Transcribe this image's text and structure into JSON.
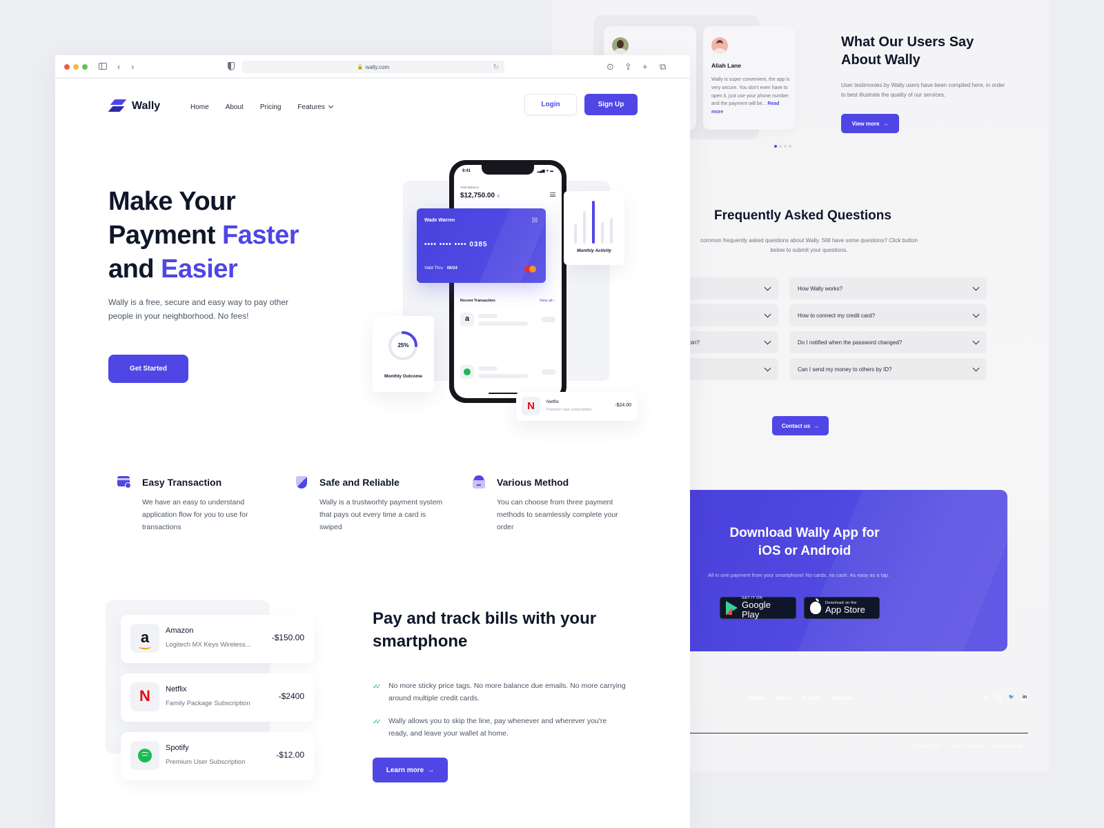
{
  "browser": {
    "url": "wally.com"
  },
  "nav": {
    "brand": "Wally",
    "links": [
      "Home",
      "About",
      "Pricing",
      "Features"
    ],
    "login": "Login",
    "signup": "Sign Up"
  },
  "hero": {
    "title_line1": "Make Your",
    "title_line2a": "Payment ",
    "title_line2b": "Faster",
    "title_line3a": "and ",
    "title_line3b": "Easier",
    "subtitle": "Wally is a free, secure and easy way to pay other people in your neighborhood. No fees!",
    "cta": "Get Started"
  },
  "phone": {
    "time": "9:41",
    "status_icons": "▂▄▆ ᯤ ▬",
    "balance_label": "Total Balance",
    "balance": "$12,750.00",
    "card_holder": "Wade Warren",
    "card_number": "•••• •••• •••• 0385",
    "valid_label": "Valid Thru",
    "valid_value": "06/24",
    "recent_label": "Recent Transaction",
    "view_all": "View all  ›",
    "activity_label": "Monthly Activity",
    "activity_bars": [
      0.45,
      0.75,
      1.0,
      0.5,
      0.6
    ],
    "outcome_label": "Monthly Outcome",
    "outcome_percent": "25%",
    "outcome_fraction": 0.25,
    "popup": {
      "name": "Netflix",
      "desc": "Premium user subscription",
      "amount": "-$24.00"
    }
  },
  "features": [
    {
      "title": "Easy Transaction",
      "desc": "We have an easy to understand application flow for you to use for transactions"
    },
    {
      "title": "Safe and Reliable",
      "desc": "Wally is a trustworhty payment system that pays out every time a card is swiped"
    },
    {
      "title": "Various Method",
      "desc": "You can choose from three payment methods to seamlessly complete your order"
    }
  ],
  "bills": [
    {
      "name": "Amazon",
      "desc": "Logitech MX Keys Wireless...",
      "amount": "-$150.00",
      "icon": "a"
    },
    {
      "name": "Netflix",
      "desc": "Family Package Subscription",
      "amount": "-$2400",
      "icon": "N"
    },
    {
      "name": "Spotify",
      "desc": "Premium User Subscription",
      "amount": "-$12.00",
      "icon": ""
    }
  ],
  "pay": {
    "title": "Pay and track bills with your smartphone",
    "points": [
      "No more sticky price tags. No more balance due emails. No more carrying around multiple credit cards.",
      "Wally allows you to skip the line, pay whenever and wherever you're ready, and leave your wallet at home."
    ],
    "cta": "Learn more",
    "check_glyph": "✓✓"
  },
  "testimonials": {
    "title": "What Our Users Say About Wally",
    "subtitle": "User testimonies by Wally users have been compiled here, in order to best illustrate the quality of our services.",
    "cta": "View more",
    "card": {
      "name": "Aliah Lane",
      "text": "Wally is super convenient, the app is very secure. You don't even have to open it, just use your phone number and the payment will be... ",
      "read_more": "Read more"
    }
  },
  "faq": {
    "title": "Frequently Asked Questions",
    "subtitle_line1": "common frequently asked questions about Wally. Still have some questions? Click button",
    "subtitle_line2": "below to submit your questions.",
    "left_items": [
      "",
      "",
      "ny pin?",
      ""
    ],
    "right_items": [
      "How Wally works?",
      "How to connect my credit card?",
      "Do I notified when the password changed?",
      "Can I send my money to others by ID?"
    ],
    "cta": "Contact us"
  },
  "download": {
    "title_line1": "Download Wally App for",
    "title_line2": "iOS or Android",
    "subtitle": "All in one payment from your smartphone! No cards, no cash. As easy as a tap.",
    "google_small": "GET IT ON",
    "google_big": "Google Play",
    "apple_small": "Download on the",
    "apple_big": "App Store"
  },
  "footer": {
    "links": [
      "Home",
      "About",
      "Pricing",
      "Features"
    ],
    "social": [
      "f",
      "",
      "🐦",
      "in"
    ],
    "legal": [
      "Privacy Policy",
      "Terms of Service",
      "Cookie Settings"
    ]
  },
  "colors": {
    "accent": "#4f46e5",
    "dark": "#0f1629",
    "footer_bg": "#101729"
  }
}
